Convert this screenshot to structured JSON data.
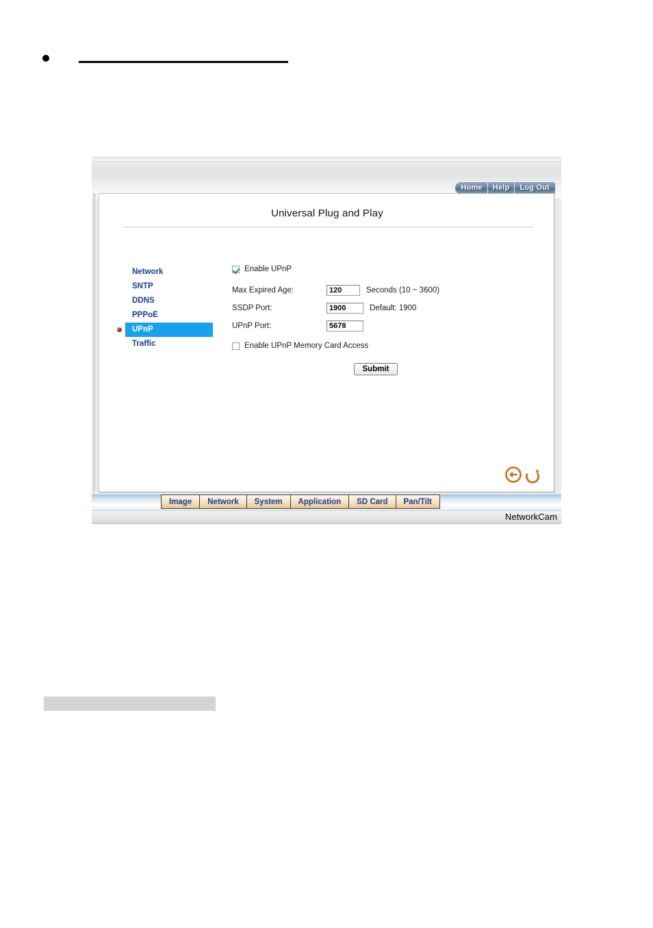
{
  "document": {
    "bullet_icon": "bullet-dot",
    "redacted_heading_rule": "",
    "redacted_gray_block": ""
  },
  "camera_ui": {
    "nav": {
      "home_label": "Home",
      "help_label": "Help",
      "logout_label": "Log Out"
    },
    "page_title": "Universal Plug and Play",
    "sidebar": {
      "items": [
        {
          "label": "Network",
          "selected": false
        },
        {
          "label": "SNTP",
          "selected": false
        },
        {
          "label": "DDNS",
          "selected": false
        },
        {
          "label": "PPPoE",
          "selected": false
        },
        {
          "label": "UPnP",
          "selected": true
        },
        {
          "label": "Traffic",
          "selected": false
        }
      ],
      "selected_bullet_icon": "red-dot-icon",
      "highlight_color": "#1ba1ea",
      "link_color": "#1b3a8f"
    },
    "form": {
      "enable_upnp": {
        "label": "Enable UPnP",
        "checked": true
      },
      "max_expired_age": {
        "label": "Max Expired Age:",
        "value": "120",
        "hint": "Seconds (10 ~ 3600)"
      },
      "ssdp_port": {
        "label": "SSDP Port:",
        "value": "1900",
        "hint": "Default: 1900"
      },
      "upnp_port": {
        "label": "UPnP Port:",
        "value": "5678",
        "hint": ""
      },
      "enable_memory_card_access": {
        "label": "Enable UPnP Memory Card Access",
        "checked": false
      },
      "submit_label": "Submit"
    },
    "corner_icons": {
      "back_icon": "back-arrow-circle-icon",
      "reload_icon": "reload-arrow-icon",
      "color": "#c8701a"
    },
    "tabs": [
      {
        "label": "Image"
      },
      {
        "label": "Network"
      },
      {
        "label": "System"
      },
      {
        "label": "Application"
      },
      {
        "label": "SD Card"
      },
      {
        "label": "Pan/Tilt"
      }
    ],
    "footer_brand": "NetworkCam"
  }
}
